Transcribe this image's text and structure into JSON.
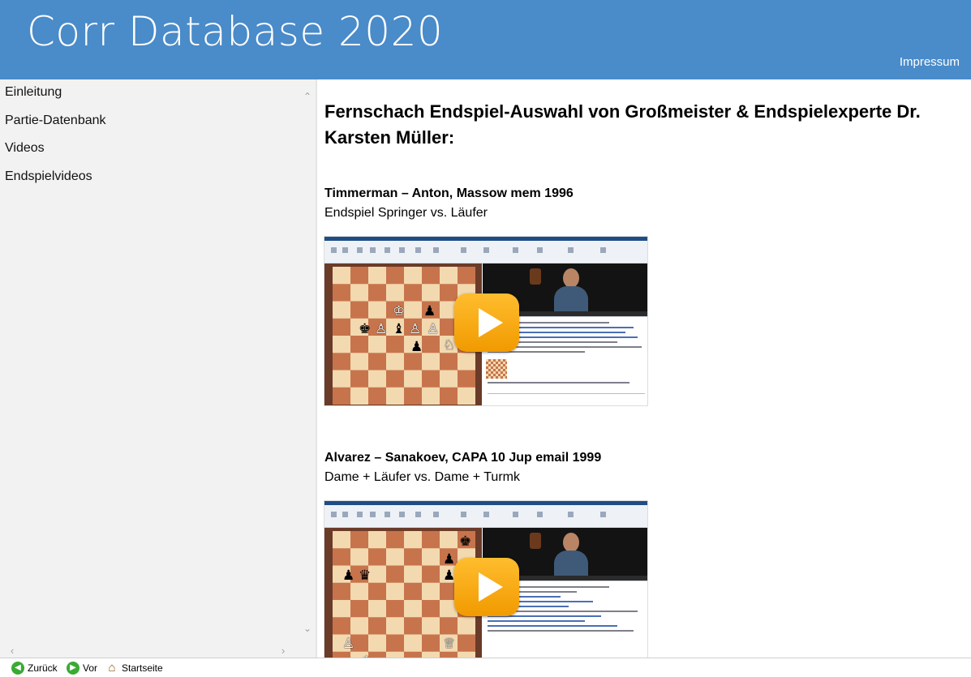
{
  "header": {
    "title": "Corr Database 2020",
    "impressum_label": "Impressum"
  },
  "sidebar": {
    "items": [
      {
        "label": "Einleitung"
      },
      {
        "label": "Partie-Datenbank"
      },
      {
        "label": "Videos"
      },
      {
        "label": "Endspielvideos"
      }
    ]
  },
  "main": {
    "heading": "Fernschach Endspiel-Auswahl von Großmeister & Endspielexperte Dr. Karsten Müller:",
    "games": [
      {
        "title": "Timmerman – Anton, Massow mem 1996",
        "subtitle": "Endspiel Springer vs. Läufer"
      },
      {
        "title": "Alvarez – Sanakoev, CAPA 10 Jup email 1999",
        "subtitle": "Dame + Läufer vs. Dame + Turmk"
      }
    ]
  },
  "toolbar": {
    "back_label": "Zurück",
    "forward_label": "Vor",
    "home_label": "Startseite"
  },
  "colors": {
    "header_bg": "#4a8bc9",
    "sidebar_bg": "#f2f2f2",
    "play_button": "#f5a300",
    "nav_icon_green": "#3aaa35"
  },
  "icons": {
    "back": "arrow-left-circle-icon",
    "forward": "arrow-right-circle-icon",
    "home": "home-icon",
    "play": "play-icon"
  }
}
